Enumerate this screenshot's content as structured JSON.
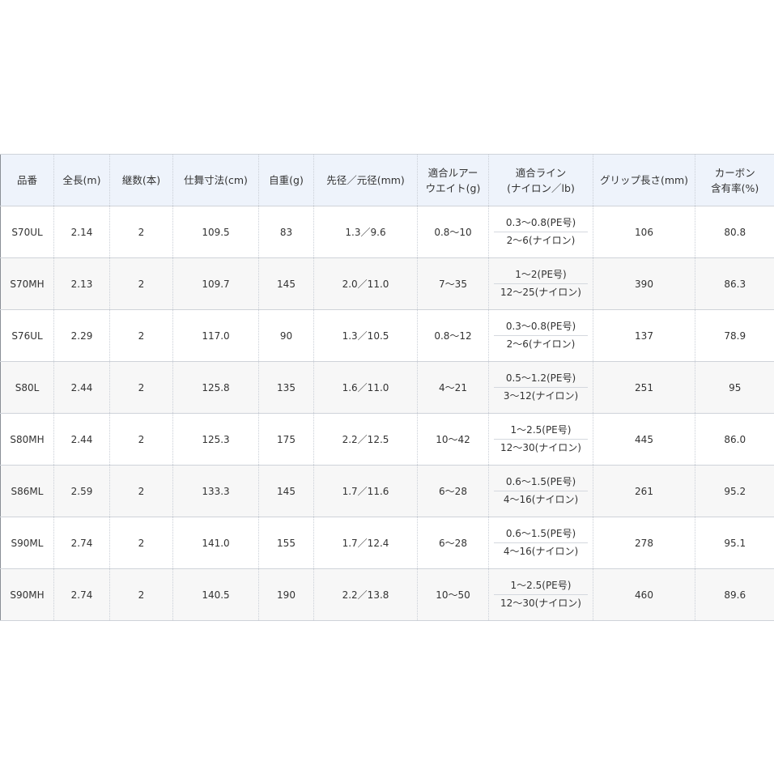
{
  "headers": [
    {
      "lines": [
        "品番"
      ]
    },
    {
      "lines": [
        "全長(m)"
      ]
    },
    {
      "lines": [
        "継数(本)"
      ]
    },
    {
      "lines": [
        "仕舞寸法(cm)"
      ]
    },
    {
      "lines": [
        "自重(g)"
      ]
    },
    {
      "lines": [
        "先径／元径(mm)"
      ]
    },
    {
      "lines": [
        "適合ルアー",
        "ウエイト(g)"
      ]
    },
    {
      "lines": [
        "適合ライン",
        "(ナイロン／lb)"
      ]
    },
    {
      "lines": [
        "グリップ長さ(mm)"
      ]
    },
    {
      "lines": [
        "カーボン",
        "含有率(%)"
      ]
    }
  ],
  "rows": [
    {
      "model": "S70UL",
      "length": "2.14",
      "pieces": "2",
      "closed": "109.5",
      "weight": "83",
      "diameter": "1.3／9.6",
      "lure": "0.8～10",
      "line_pe": "0.3～0.8(PE号)",
      "line_nylon": "2～6(ナイロン)",
      "grip": "106",
      "carbon": "80.8"
    },
    {
      "model": "S70MH",
      "length": "2.13",
      "pieces": "2",
      "closed": "109.7",
      "weight": "145",
      "diameter": "2.0／11.0",
      "lure": "7～35",
      "line_pe": "1～2(PE号)",
      "line_nylon": "12～25(ナイロン)",
      "grip": "390",
      "carbon": "86.3"
    },
    {
      "model": "S76UL",
      "length": "2.29",
      "pieces": "2",
      "closed": "117.0",
      "weight": "90",
      "diameter": "1.3／10.5",
      "lure": "0.8～12",
      "line_pe": "0.3～0.8(PE号)",
      "line_nylon": "2～6(ナイロン)",
      "grip": "137",
      "carbon": "78.9"
    },
    {
      "model": "S80L",
      "length": "2.44",
      "pieces": "2",
      "closed": "125.8",
      "weight": "135",
      "diameter": "1.6／11.0",
      "lure": "4～21",
      "line_pe": "0.5～1.2(PE号)",
      "line_nylon": "3～12(ナイロン)",
      "grip": "251",
      "carbon": "95"
    },
    {
      "model": "S80MH",
      "length": "2.44",
      "pieces": "2",
      "closed": "125.3",
      "weight": "175",
      "diameter": "2.2／12.5",
      "lure": "10～42",
      "line_pe": "1～2.5(PE号)",
      "line_nylon": "12～30(ナイロン)",
      "grip": "445",
      "carbon": "86.0"
    },
    {
      "model": "S86ML",
      "length": "2.59",
      "pieces": "2",
      "closed": "133.3",
      "weight": "145",
      "diameter": "1.7／11.6",
      "lure": "6～28",
      "line_pe": "0.6～1.5(PE号)",
      "line_nylon": "4～16(ナイロン)",
      "grip": "261",
      "carbon": "95.2"
    },
    {
      "model": "S90ML",
      "length": "2.74",
      "pieces": "2",
      "closed": "141.0",
      "weight": "155",
      "diameter": "1.7／12.4",
      "lure": "6～28",
      "line_pe": "0.6～1.5(PE号)",
      "line_nylon": "4～16(ナイロン)",
      "grip": "278",
      "carbon": "95.1"
    },
    {
      "model": "S90MH",
      "length": "2.74",
      "pieces": "2",
      "closed": "140.5",
      "weight": "190",
      "diameter": "2.2／13.8",
      "lure": "10～50",
      "line_pe": "1～2.5(PE号)",
      "line_nylon": "12～30(ナイロン)",
      "grip": "460",
      "carbon": "89.6"
    }
  ]
}
